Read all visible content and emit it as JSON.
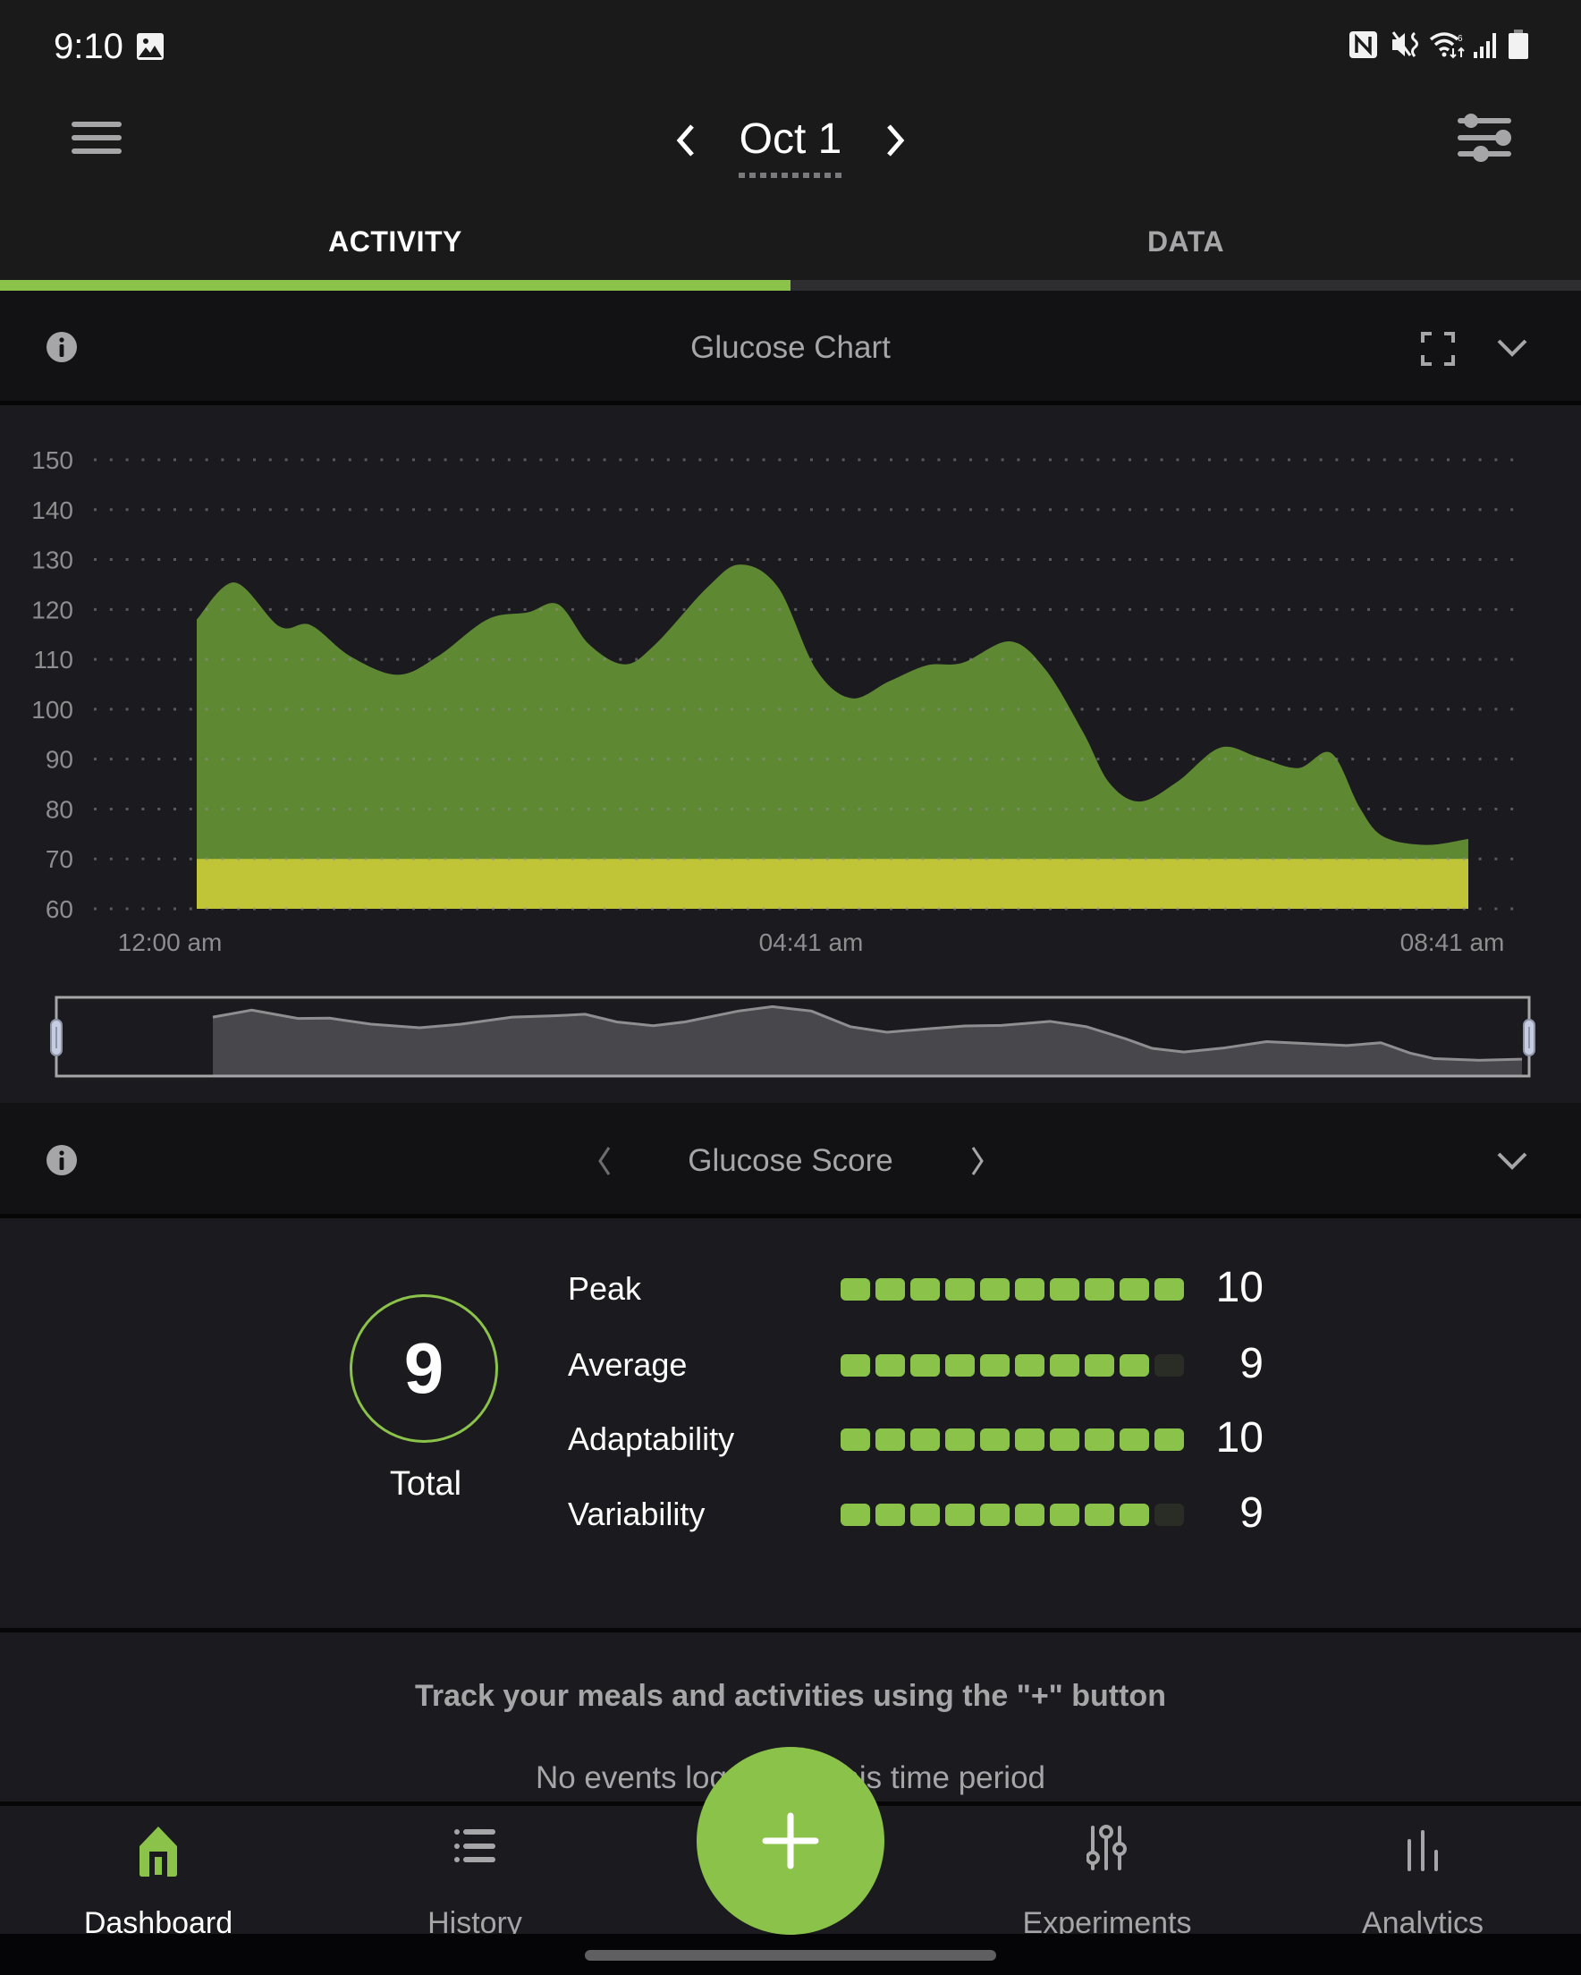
{
  "status_bar": {
    "time": "9:10",
    "left_icons": [
      "image-icon"
    ],
    "right_icons": [
      "nfc-icon",
      "vibrate-mute-icon",
      "wifi-icon",
      "signal-icon",
      "battery-icon"
    ]
  },
  "app_bar": {
    "menu_icon": "hamburger-menu-icon",
    "date": "Oct 1",
    "prev_icon": "chevron-left-icon",
    "next_icon": "chevron-right-icon",
    "filter_icon": "sliders-icon"
  },
  "tabs": [
    {
      "label": "ACTIVITY",
      "active": true
    },
    {
      "label": "DATA",
      "active": false
    }
  ],
  "colors": {
    "accent": "#8bc34a",
    "area_fill": "#5f8833",
    "low_band": "#c0c437",
    "navigator_fill": "#48474b",
    "background": "#1b1a1e"
  },
  "glucose_chart": {
    "title": "Glucose Chart"
  },
  "chart_data": {
    "type": "area",
    "title": "Glucose Chart",
    "xlabel": "",
    "ylabel": "",
    "ylim": [
      60,
      150
    ],
    "yticks": [
      150,
      140,
      130,
      120,
      110,
      100,
      90,
      80,
      70,
      60
    ],
    "xtick_labels": [
      "12:00 am",
      "04:41 am",
      "08:41 am"
    ],
    "x_range_minutes": [
      0,
      521
    ],
    "grid": "dotted-horizontal",
    "low_threshold_band": [
      60,
      70
    ],
    "series": [
      {
        "name": "Glucose",
        "x_minutes": [
          10,
          26,
          45,
          58,
          75,
          95,
          112,
          133,
          150,
          163,
          176,
          191,
          204,
          226,
          240,
          256,
          272,
          287,
          303,
          319,
          334,
          354,
          369,
          385,
          396,
          409,
          425,
          443,
          459,
          476,
          490,
          502,
          512,
          530,
          548
        ],
        "values": [
          118,
          125.4,
          116.6,
          116.9,
          110.6,
          106.9,
          110.6,
          118,
          119.4,
          121,
          113,
          109,
          113,
          124.4,
          129,
          124.4,
          108,
          102.2,
          105.6,
          108.8,
          109.3,
          113.6,
          108,
          95.4,
          85.3,
          81.5,
          85.5,
          92.3,
          90.4,
          88.2,
          91.2,
          80.3,
          74.5,
          72.8,
          74
        ]
      }
    ],
    "navigator": {
      "range_start": 0.0,
      "range_end": 1.0
    }
  },
  "glucose_score": {
    "title": "Glucose Score",
    "total_value": "9",
    "total_label": "Total",
    "max_segments": 10,
    "rows": [
      {
        "label": "Peak",
        "value": "10",
        "filled": 10
      },
      {
        "label": "Average",
        "value": "9",
        "filled": 9
      },
      {
        "label": "Adaptability",
        "value": "10",
        "filled": 10
      },
      {
        "label": "Variability",
        "value": "9",
        "filled": 9
      }
    ]
  },
  "events": {
    "hint": "Track your meals and activities using the \"+\" button",
    "empty": "No events logged for this time period"
  },
  "fab": {
    "icon": "plus-icon"
  },
  "bottom_nav": [
    {
      "label": "Dashboard",
      "icon": "home-icon",
      "active": true
    },
    {
      "label": "History",
      "icon": "list-icon",
      "active": false
    },
    {
      "label": "Experiments",
      "icon": "sliders-vertical-icon",
      "active": false
    },
    {
      "label": "Analytics",
      "icon": "bar-chart-icon",
      "active": false
    }
  ]
}
